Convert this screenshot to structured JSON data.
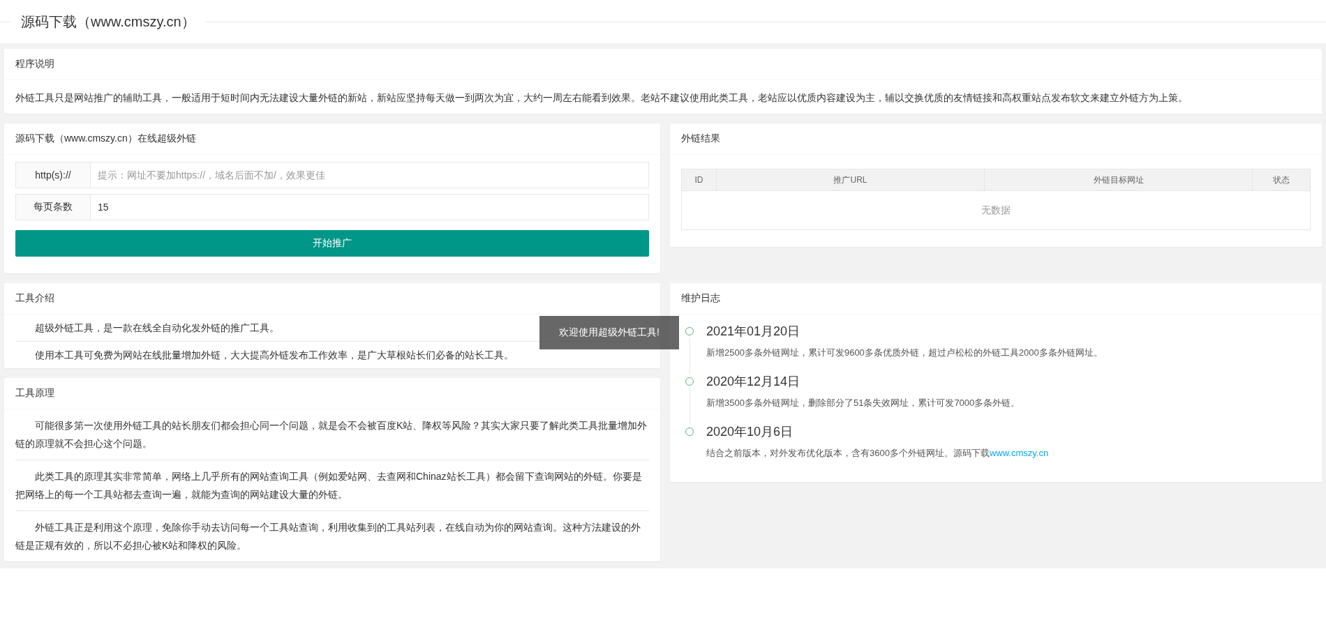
{
  "header": {
    "title": "源码下载（www.cmszy.cn）"
  },
  "notice": {
    "title": "程序说明",
    "text": "外链工具只是网站推广的辅助工具，一般适用于短时间内无法建设大量外链的新站，新站应坚持每天做一到两次为宜，大约一周左右能看到效果。老站不建议使用此类工具，老站应以优质内容建设为主，辅以交换优质的友情链接和高权重站点发布软文来建立外链方为上策。"
  },
  "form_panel": {
    "title": "源码下载（www.cmszy.cn）在线超级外链",
    "fields": [
      {
        "label": "http(s)://",
        "placeholder": "提示：网址不要加https://，域名后面不加/，效果更佳"
      },
      {
        "label": "每页条数",
        "value": "15"
      }
    ],
    "submit": "开始推广"
  },
  "results": {
    "title": "外链结果",
    "columns": [
      "ID",
      "推广URL",
      "外链目标网址",
      "状态"
    ],
    "empty_text": "无数据"
  },
  "intro": {
    "title": "工具介绍",
    "paragraphs": [
      "超级外链工具，是一款在线全自动化发外链的推广工具。",
      "使用本工具可免费为网站在线批量增加外链，大大提高外链发布工作效率，是广大草根站长们必备的站长工具。"
    ]
  },
  "principle": {
    "title": "工具原理",
    "paragraphs": [
      "可能很多第一次使用外链工具的站长朋友们都会担心同一个问题，就是会不会被百度K站、降权等风险？其实大家只要了解此类工具批量增加外链的原理就不会担心这个问题。",
      "此类工具的原理其实非常简单，网络上几乎所有的网站查询工具（例如爱站网、去查网和Chinaz站长工具）都会留下查询网站的外链。你要是把网络上的每一个工具站都去查询一遍，就能为查询的网站建设大量的外链。",
      "外链工具正是利用这个原理，免除你手动去访问每一个工具站查询，利用收集到的工具站列表，在线自动为你的网站查询。这种方法建设的外链是正规有效的，所以不必担心被K站和降权的风险。"
    ]
  },
  "log": {
    "title": "维护日志",
    "entries": [
      {
        "date": "2021年01月20日",
        "text": "新增2500多条外链网址，累计可发9600多条优质外链，超过卢松松的外链工具2000多条外链网址。"
      },
      {
        "date": "2020年12月14日",
        "text": "新增3500多条外链网址，删除部分了51条失效网址，累计可发7000多条外链。"
      },
      {
        "date": "2020年10月6日",
        "text": "结合之前版本，对外发布优化版本，含有3600多个外链网址。源码下载",
        "link": "www.cmszy.cn"
      }
    ]
  },
  "toast": {
    "text": "欢迎使用超级外链工具!"
  }
}
